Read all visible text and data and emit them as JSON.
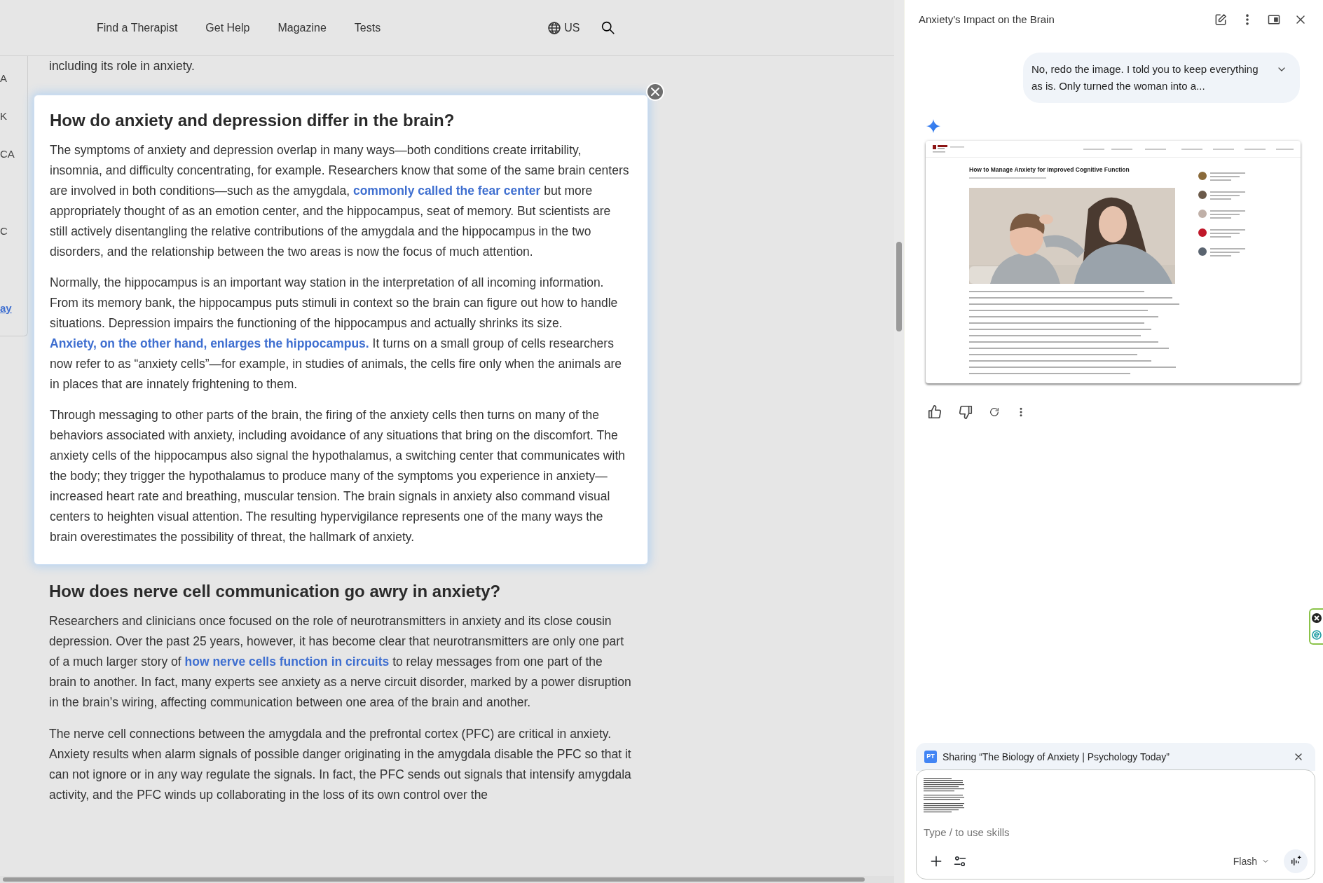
{
  "nav": {
    "links": [
      {
        "label": "Find a Therapist"
      },
      {
        "label": "Get Help"
      },
      {
        "label": "Magazine"
      },
      {
        "label": "Tests"
      }
    ],
    "region": "US"
  },
  "sidebar_fragments": [
    {
      "text": "A",
      "kind": "text"
    },
    {
      "text": "K",
      "kind": "text"
    },
    {
      "text": "CA",
      "kind": "text"
    },
    {
      "text": "C",
      "kind": "text"
    },
    {
      "text": "ay",
      "kind": "link"
    }
  ],
  "article": {
    "intro": "including its role in anxiety.",
    "highlighted": {
      "heading": "How do anxiety and depression differ in the brain?",
      "paragraphs": [
        [
          {
            "text": "The symptoms of anxiety and depression overlap in many ways—both conditions create irritability, insomnia, and difficulty concentrating, for example. Researchers know that some of the same brain centers are involved in both conditions—such as the amygdala, "
          },
          {
            "text": "commonly called the fear center",
            "kind": "link"
          },
          {
            "text": " but more appropriately thought of as an emotion center, and the hippocampus, seat of memory. But scientists are still actively disentangling the relative contributions of the amygdala and the hippocampus in the two disorders, and the relationship between the two areas is now the focus of much attention."
          }
        ],
        [
          {
            "text": "Normally, the hippocampus is an important way station in the interpretation of all incoming information. From its memory bank, the hippocampus puts stimuli in context so the brain can figure out how to handle situations. Depression impairs the functioning of the hippocampus and actually shrinks its size. "
          },
          {
            "text": "Anxiety, on the other hand, enlarges the hippocampus.",
            "kind": "link"
          },
          {
            "text": " It turns on a small group of cells researchers now refer to as “anxiety cells”—for example, in studies of animals, the cells fire only when the animals are in places that are innately frightening to them."
          }
        ],
        [
          {
            "text": "Through messaging to other parts of the brain, the firing of the anxiety cells then turns on many of the behaviors associated with anxiety, including avoidance of any situations that bring on the discomfort. The anxiety cells of the hippocampus also signal the hypothalamus, a switching center that communicates with the body; they trigger the hypothalamus to produce many of the symptoms you experience in anxiety— increased heart rate and breathing, muscular tension. The brain signals in anxiety also command visual centers to heighten visual attention. The resulting hypervigilance represents one of the many ways the brain overestimates the possibility of threat, the hallmark of anxiety."
          }
        ]
      ]
    },
    "sections": [
      {
        "heading": "How does nerve cell communication go awry in anxiety?",
        "paragraphs": [
          [
            {
              "text": "Researchers and clinicians once focused on the role of neurotransmitters in anxiety and its close cousin depression. Over the past 25 years, however, it has become clear that neurotransmitters are only one part of a much larger story of "
            },
            {
              "text": "how nerve cells function in circuits",
              "kind": "link"
            },
            {
              "text": " to relay messages from one part of the brain to another. In fact, many experts see anxiety as a nerve circuit disorder, marked by a power disruption in the brain’s wiring, affecting communication between one area of the brain and another."
            }
          ],
          [
            {
              "text": "The nerve cell connections between the amygdala and the prefrontal cortex (PFC) are critical in anxiety. Anxiety results when alarm signals of possible danger originating in the amygdala disable the PFC so that it can not ignore or in any way regulate the signals. In fact, the PFC sends out signals that intensify amygdala activity, and the PFC winds up collaborating in the loss of its own control over the"
            }
          ]
        ]
      }
    ]
  },
  "chat": {
    "title": "Anxiety's Impact on the Brain",
    "user_message": "No, redo the image. I told you to keep everything as is. Only turned the woman into a...",
    "response_image": {
      "title": "How to Manage Anxiety for Improved Cognitive Function"
    },
    "sharing": {
      "favicon": "PT",
      "label": "Sharing “The Biology of Anxiety | Psychology Today”"
    },
    "input": {
      "placeholder": "Type / to use skills"
    },
    "model": "Flash"
  }
}
